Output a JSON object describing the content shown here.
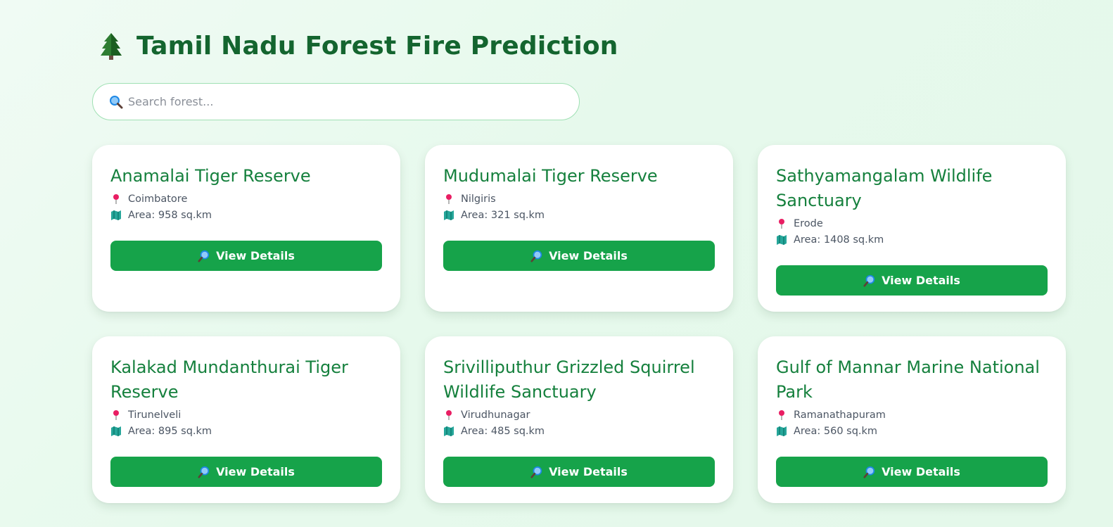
{
  "header": {
    "title": "Tamil Nadu Forest Fire Prediction",
    "icon": "evergreen-tree-icon"
  },
  "search": {
    "placeholder": "Search forest...",
    "value": "",
    "icon": "magnifier-icon"
  },
  "colors": {
    "primary_green": "#16a34a",
    "title_green": "#14652f",
    "card_title_green": "#15803d",
    "pin_pink": "#db2777",
    "map_teal": "#0e7490"
  },
  "forests": [
    {
      "name": "Anamalai Tiger Reserve",
      "district": "Coimbatore",
      "area": "Area: 958 sq.km",
      "button": "View Details"
    },
    {
      "name": "Mudumalai Tiger Reserve",
      "district": "Nilgiris",
      "area": "Area: 321 sq.km",
      "button": "View Details"
    },
    {
      "name": "Sathyamangalam Wildlife Sanctuary",
      "district": "Erode",
      "area": "Area: 1408 sq.km",
      "button": "View Details"
    },
    {
      "name": "Kalakad Mundanthurai Tiger Reserve",
      "district": "Tirunelveli",
      "area": "Area: 895 sq.km",
      "button": "View Details"
    },
    {
      "name": "Srivilliputhur Grizzled Squirrel Wildlife Sanctuary",
      "district": "Virudhunagar",
      "area": "Area: 485 sq.km",
      "button": "View Details"
    },
    {
      "name": "Gulf of Mannar Marine National Park",
      "district": "Ramanathapuram",
      "area": "Area: 560 sq.km",
      "button": "View Details"
    }
  ]
}
